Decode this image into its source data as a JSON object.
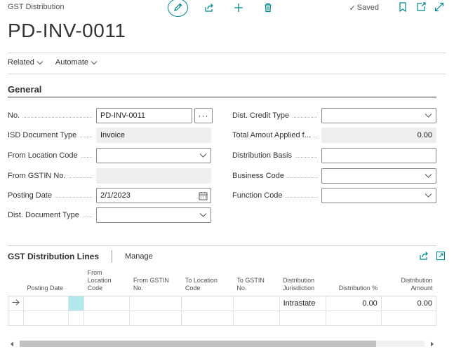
{
  "page": {
    "caption": "GST Distribution",
    "record_no": "PD-INV-0011",
    "status": "Saved"
  },
  "icons": {
    "edit": "pencil-icon",
    "share": "share-icon",
    "new": "plus-icon",
    "delete": "trash-icon",
    "bookmark": "bookmark-icon",
    "open_new": "open-in-new-window-icon",
    "expand": "expand-icon"
  },
  "menu": {
    "related": "Related",
    "automate": "Automate"
  },
  "general": {
    "title": "General",
    "fields_left": [
      {
        "label": "No.",
        "value": "PD-INV-0011"
      },
      {
        "label": "ISD Document Type",
        "value": "Invoice"
      },
      {
        "label": "From Location Code",
        "value": ""
      },
      {
        "label": "From GSTIN No.",
        "value": ""
      },
      {
        "label": "Posting Date",
        "value": "2/1/2023"
      },
      {
        "label": "Dist. Document Type",
        "value": ""
      }
    ],
    "fields_right": [
      {
        "label": "Dist. Credit Type",
        "value": ""
      },
      {
        "label": "Total Amout Applied f...",
        "value": "0.00"
      },
      {
        "label": "Distribution Basis",
        "value": ""
      },
      {
        "label": "Business Code",
        "value": ""
      },
      {
        "label": "Function Code",
        "value": ""
      }
    ],
    "assist_button": "···"
  },
  "lines": {
    "title": "GST Distribution Lines",
    "manage": "Manage",
    "columns": [
      "Posting Date",
      "From Location Code",
      "From GSTIN No.",
      "To Location Code",
      "To GSTIN No.",
      "Distribution Jurisdiction",
      "Distribution %",
      "Distribution Amount"
    ],
    "row": {
      "posting_date": "",
      "from_location": "",
      "from_gstin": "",
      "to_location": "",
      "to_gstin": "",
      "jurisdiction": "Intrastate",
      "dist_pct": "0.00",
      "dist_amount": "0.00"
    }
  },
  "colors": {
    "accent": "#008489",
    "selected_cell": "#b2e8ee",
    "readonly_bg": "#efefef"
  }
}
